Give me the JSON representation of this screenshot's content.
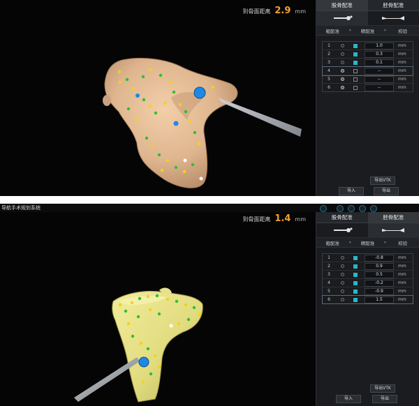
{
  "colors": {
    "accent_value": "#f0a030",
    "checkbox_on": "#2ab6c8",
    "femur_bone": "#e8c09b",
    "tibia_bone": "#e6e08a",
    "point_green": "#2ec02e",
    "point_yellow": "#f2d21c",
    "point_blue": "#1e88e5",
    "point_white": "#ffffff"
  },
  "screen1": {
    "distance_label": "到骨面距离",
    "distance_value": "2.9",
    "distance_unit": "mm",
    "tabs": [
      "股骨配准",
      "胫骨配准"
    ],
    "steps": [
      "粗配准",
      "精配准",
      "校验"
    ],
    "points": [
      {
        "idx": "1",
        "radio": false,
        "checked": true,
        "value": "1.0",
        "unit": "mm"
      },
      {
        "idx": "2",
        "radio": false,
        "checked": true,
        "value": "0.3",
        "unit": "mm"
      },
      {
        "idx": "3",
        "radio": false,
        "checked": true,
        "value": "0.1",
        "unit": "mm"
      },
      {
        "idx": "4",
        "radio": true,
        "checked": false,
        "value": "--",
        "unit": "mm"
      },
      {
        "idx": "5",
        "radio": true,
        "checked": false,
        "value": "--",
        "unit": "mm"
      },
      {
        "idx": "6",
        "radio": true,
        "checked": false,
        "value": "--",
        "unit": "mm"
      }
    ],
    "export_vtk": "导出VTK",
    "import_label": "导入",
    "export_label": "导出"
  },
  "screen2": {
    "header_text": "导航手术规划系统",
    "distance_label": "到骨面距离",
    "distance_value": "1.4",
    "distance_unit": "mm",
    "tabs": [
      "股骨配准",
      "胫骨配准"
    ],
    "steps": [
      "粗配准",
      "精配准",
      "校验"
    ],
    "points": [
      {
        "idx": "1",
        "radio": false,
        "checked": true,
        "value": "-0.8",
        "unit": "mm"
      },
      {
        "idx": "2",
        "radio": false,
        "checked": true,
        "value": "0.9",
        "unit": "mm"
      },
      {
        "idx": "3",
        "radio": false,
        "checked": true,
        "value": "0.5",
        "unit": "mm"
      },
      {
        "idx": "4",
        "radio": false,
        "checked": true,
        "value": "-0.2",
        "unit": "mm"
      },
      {
        "idx": "5",
        "radio": false,
        "checked": true,
        "value": "-0.9",
        "unit": "mm"
      },
      {
        "idx": "6",
        "radio": false,
        "checked": true,
        "value": "1.5",
        "unit": "mm"
      }
    ],
    "export_vtk": "导出VTK",
    "import_label": "导入",
    "export_label": "导出"
  }
}
